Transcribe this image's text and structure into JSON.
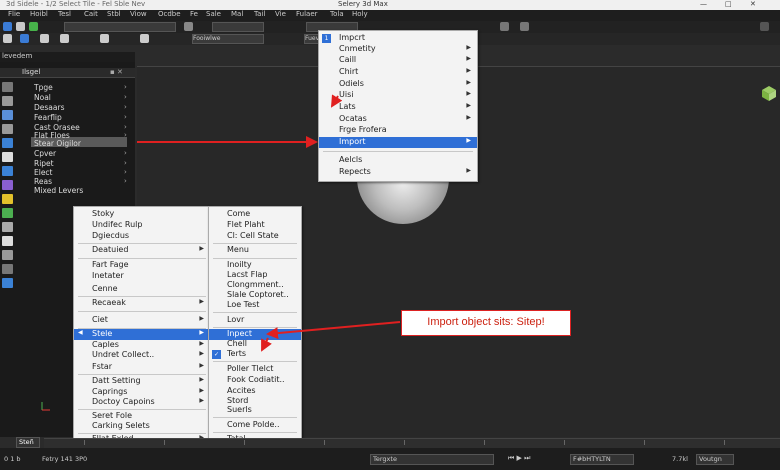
{
  "window": {
    "title_left": "3d Sidele - 1/2 Select Tile - Fel Sble Nev",
    "title_center": "Selery 3d Max",
    "controls": [
      "—",
      "□",
      "✕"
    ]
  },
  "menubar": [
    "Flie",
    "Hoibl",
    "Tesl",
    "Cait",
    "Stbl",
    "Viow",
    "Ocdbe",
    "Fe",
    "Sale",
    "Mal",
    "Tail",
    "Vie",
    "Fulaer",
    "Tola",
    "Holy"
  ],
  "tabs": {
    "left_tab": "levedem"
  },
  "panel": {
    "header": "Ilsgel",
    "items": [
      "Tpge",
      "Noal",
      "Desaars",
      "Fearflip",
      "Cast Orasee",
      "Flat Floes",
      "Stear Oigilor",
      "Cpver",
      "Ripet",
      "Elect",
      "Reas",
      "Mixed Levers"
    ],
    "selected": "Stear Oigilor"
  },
  "menu_top": {
    "items": [
      {
        "label": "Impcrt",
        "arrow": false,
        "checked": true
      },
      {
        "label": "Cnmetity",
        "arrow": true
      },
      {
        "label": "Caill",
        "arrow": true
      },
      {
        "label": "Chirt",
        "arrow": true
      },
      {
        "label": "Odiels",
        "arrow": true
      },
      {
        "label": "Uisi",
        "arrow": true
      },
      {
        "label": "Lats",
        "arrow": true
      },
      {
        "label": "Ocatas",
        "arrow": true
      },
      {
        "label": "Frge Frofera",
        "arrow": false
      },
      {
        "label": "Import",
        "arrow": true,
        "highlight": true
      },
      {
        "label": "Aelcls",
        "arrow": false
      },
      {
        "label": "Repects",
        "arrow": true
      }
    ]
  },
  "menu_left": {
    "items": [
      {
        "label": "Stoky"
      },
      {
        "label": "Undifec Rulp"
      },
      {
        "label": "Dgiecdus"
      },
      {
        "label": "Deatuied",
        "arrow": true
      },
      {
        "label": "Fart Fage"
      },
      {
        "label": "Inetater"
      },
      {
        "label": "Cenne"
      },
      {
        "label": "Recaeak",
        "arrow": true
      },
      {
        "label": "Ciet",
        "arrow": true
      },
      {
        "label": "Stele",
        "arrow": true,
        "highlight": true
      },
      {
        "label": "Caples",
        "arrow": true
      },
      {
        "label": "Undret Collect..",
        "arrow": true
      },
      {
        "label": "Fstar",
        "arrow": true
      },
      {
        "label": "Datt Setting",
        "arrow": true
      },
      {
        "label": "Caprings",
        "arrow": true
      },
      {
        "label": "Doctoy Capoins",
        "arrow": true
      },
      {
        "label": "Seret Fole"
      },
      {
        "label": "Carking Selets"
      },
      {
        "label": "Fllat Exlod",
        "arrow": true
      }
    ]
  },
  "menu_right": {
    "items": [
      {
        "label": "Come"
      },
      {
        "label": "Flet Plaht"
      },
      {
        "label": "Cl: Cell State"
      },
      {
        "label": "Menu"
      },
      {
        "label": "Inoilty"
      },
      {
        "label": "Lacst Flap"
      },
      {
        "label": "Clongmment.."
      },
      {
        "label": "Slale Coptoret.."
      },
      {
        "label": "Loe Test"
      },
      {
        "label": "Lovr"
      },
      {
        "label": "Inpect",
        "highlight": true
      },
      {
        "label": "Chell"
      },
      {
        "label": "Terts",
        "checked": true
      },
      {
        "label": "Poller Tlelct"
      },
      {
        "label": "Fook Codiatit.."
      },
      {
        "label": "Accites"
      },
      {
        "label": "Stord"
      },
      {
        "label": "Suerls"
      },
      {
        "label": "Come Polde.."
      },
      {
        "label": "Tatal"
      }
    ]
  },
  "callout": {
    "text": "Import object sits: Sitep!"
  },
  "toolbar": {
    "field1": "Fooiwlwe",
    "field2": "Fuevaabit"
  },
  "status": {
    "left_btn": "Steñ",
    "coords": "0 1 b",
    "info": "Fetry 141 3P0",
    "field_mid": "Tergxte",
    "field_right": "F#bHTYLTN",
    "zoom": "7.7kl",
    "mode": "Voutgn"
  },
  "colors": {
    "highlight": "#2f6fd6",
    "arrow": "#e02020",
    "callout_border": "#d22222"
  }
}
